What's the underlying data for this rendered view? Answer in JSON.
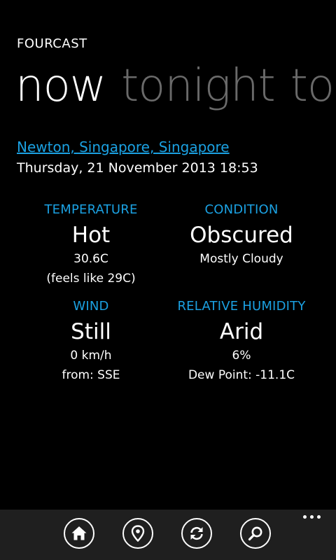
{
  "app": {
    "title": "FOURCAST"
  },
  "pivot": {
    "items": [
      "now",
      "tonight",
      "to"
    ],
    "active_index": 0
  },
  "location": {
    "name": "Newton, Singapore, Singapore",
    "datetime": "Thursday, 21 November 2013 18:53"
  },
  "weather": {
    "temperature": {
      "label": "TEMPERATURE",
      "value": "Hot",
      "detail1": "30.6C",
      "detail2": "(feels like 29C)"
    },
    "condition": {
      "label": "CONDITION",
      "value": "Obscured",
      "detail1": "Mostly Cloudy"
    },
    "wind": {
      "label": "WIND",
      "value": "Still",
      "detail1": "0 km/h",
      "detail2": "from: SSE"
    },
    "humidity": {
      "label": "RELATIVE HUMIDITY",
      "value": "Arid",
      "detail1": "6%",
      "detail2": "Dew Point: -11.1C"
    }
  },
  "app_bar": {
    "buttons": [
      "home-icon",
      "location-pin-icon",
      "refresh-icon",
      "search-icon"
    ],
    "more": "more-icon"
  },
  "colors": {
    "accent": "#1ba1e2",
    "background": "#000000",
    "inactive_pivot": "#6a6a6a",
    "app_bar": "#1f1f1f"
  }
}
